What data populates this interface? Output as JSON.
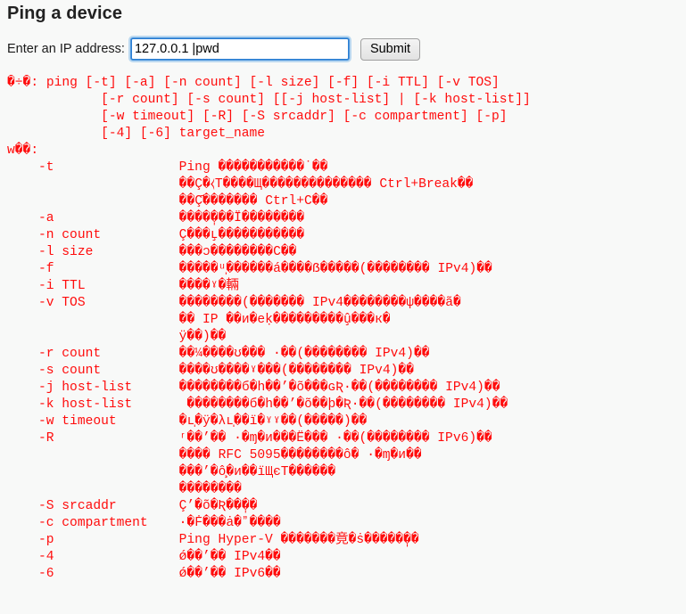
{
  "page": {
    "title": "Ping a device",
    "background_color": "#f8f9f8",
    "text_color": "#111111"
  },
  "form": {
    "label": "Enter an IP address:",
    "input_value": "127.0.0.1 |pwd",
    "input_placeholder": "",
    "input_focus_color": "#2d7fd3",
    "submit_label": "Submit"
  },
  "console": {
    "text_color": "#ff0c0c",
    "usage_lines": [
      "�÷�: ping [-t] [-a] [-n count] [-l size] [-f] [-i TTL] [-v TOS]",
      "            [-r count] [-s count] [[-j host-list] | [-k host-list]]",
      "            [-w timeout] [-R] [-S srcaddr] [-c compartment] [-p]",
      "            [-4] [-6] target_name"
    ],
    "options_header": "w��:",
    "options": [
      {
        "flag": "    -t",
        "description_lines": [
          "Ping �����������˙��",
          "��Ç�⧼T����Щ�������������� Ctrl+Break��",
          "��Ç᷄������� Ctrl+C��"
        ]
      },
      {
        "flag": "    -a",
        "description_lines": [
          "����̩���Ï��������"
        ]
      },
      {
        "flag": "    -n count",
        "description_lines": [
          "Ç���̧ʟ�����������"
        ]
      },
      {
        "flag": "    -l size",
        "description_lines": [
          "���ɔ��������C��"
        ]
      },
      {
        "flag": "    -f",
        "description_lines": [
          "�����ᵘ̩������á����ẞ�����(�������� IPv4)��"
        ]
      },
      {
        "flag": "    -i TTL",
        "description_lines": [
          "����ˠ�輛"
        ]
      },
      {
        "flag": "    -v TOS",
        "description_lines": [
          "��������(������� IPv4��������ψ����ã�",
          "�� IP ��и�eḳ���������̧û���к�",
          "ÿ��)��"
        ]
      },
      {
        "flag": "    -r count",
        "description_lines": [
          "��¼����ʊ��� ·��(�������� IPv4)��"
        ]
      },
      {
        "flag": "    -s count",
        "description_lines": [
          "����ʊ����ˠ���(�������� IPv4)��"
        ]
      },
      {
        "flag": "    -j host-list",
        "description_lines": [
          "��������б�h��’�õ���ɢƦ·��(�������� IPv4)��"
        ]
      },
      {
        "flag": "    -k host-list",
        "description_lines": [
          " ��������б�h��’�õ��þ�Ʀ·��(�������� IPv4)��"
        ]
      },
      {
        "flag": "    -w timeout",
        "description_lines": [
          "�ʟ̩�ÿ�λʟ̩��ї�ˠˠ��(�����)��"
        ]
      },
      {
        "flag": "    -R",
        "description_lines": [
          "ʳ��’�� ·�ɱ�и���Ё��� ·��(�������� IPv6)��",
          "���� RFC 5095��������ô� ·�ɱ�и��",
          "���’�ô̧�и��ïЩєT������",
          "��������"
        ]
      },
      {
        "flag": "    -S srcaddr",
        "description_lines": [
          "Ç’�õ�Ʀ��̩��"
        ]
      },
      {
        "flag": "    -c compartment",
        "description_lines": [
          "·�Ḟ���ȧ�ˮ����"
        ]
      },
      {
        "flag": "    -p",
        "description_lines": [
          "Ping Hyper-V �������竟�ṡ�����̩��"
        ]
      },
      {
        "flag": "    -4",
        "description_lines": [
          "ǿ��’�� IPv4��"
        ]
      },
      {
        "flag": "    -6",
        "description_lines": [
          "ǿ��’�� IPv6��"
        ]
      }
    ]
  }
}
